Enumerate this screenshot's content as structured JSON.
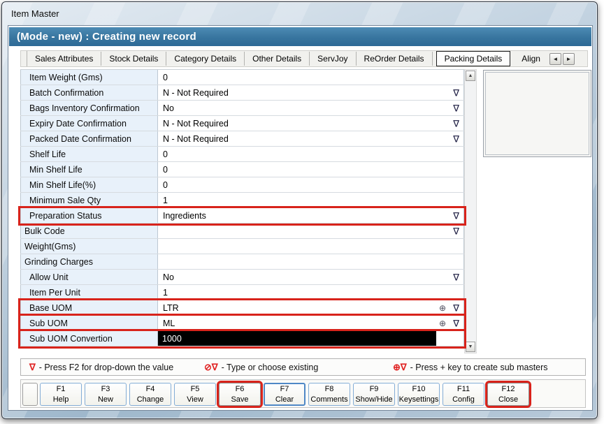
{
  "window": {
    "title": "Item Master"
  },
  "header": {
    "title": "(Mode - new) : Creating new record"
  },
  "icons": {
    "dropdown": "∇",
    "circle_plus": "⊕",
    "circle_slash": "⊘",
    "scroll_up": "▲",
    "scroll_down": "▼",
    "tab_scroll_left": "◄",
    "tab_scroll_right": "►"
  },
  "tabs": {
    "items": [
      {
        "label": "Sales Attributes",
        "selected": false
      },
      {
        "label": "Stock Details",
        "selected": false
      },
      {
        "label": "Category Details",
        "selected": false
      },
      {
        "label": "Other Details",
        "selected": false
      },
      {
        "label": "ServJoy",
        "selected": false
      },
      {
        "label": "ReOrder Details",
        "selected": false
      },
      {
        "label": "Packing Details",
        "selected": true
      },
      {
        "label": "Align",
        "selected": false
      }
    ]
  },
  "form": {
    "rows": [
      {
        "label": "Item Weight (Gms)",
        "value": "0",
        "indicator": "none",
        "highlight": false,
        "outdent": false,
        "selected": false
      },
      {
        "label": "Batch Confirmation",
        "value": "N - Not Required",
        "indicator": "dropdown",
        "highlight": false,
        "outdent": false,
        "selected": false
      },
      {
        "label": "Bags Inventory Confirmation",
        "value": "No",
        "indicator": "dropdown",
        "highlight": false,
        "outdent": false,
        "selected": false
      },
      {
        "label": "Expiry Date Confirmation",
        "value": "N - Not Required",
        "indicator": "dropdown",
        "highlight": false,
        "outdent": false,
        "selected": false
      },
      {
        "label": "Packed Date Confirmation",
        "value": "N - Not Required",
        "indicator": "dropdown",
        "highlight": false,
        "outdent": false,
        "selected": false
      },
      {
        "label": "Shelf Life",
        "value": "0",
        "indicator": "none",
        "highlight": false,
        "outdent": false,
        "selected": false
      },
      {
        "label": "Min Shelf Life",
        "value": "0",
        "indicator": "none",
        "highlight": false,
        "outdent": false,
        "selected": false
      },
      {
        "label": "Min Shelf Life(%)",
        "value": "0",
        "indicator": "none",
        "highlight": false,
        "outdent": false,
        "selected": false
      },
      {
        "label": "Minimum Sale Qty",
        "value": "1",
        "indicator": "none",
        "highlight": false,
        "outdent": false,
        "selected": false
      },
      {
        "label": "Preparation Status",
        "value": "Ingredients",
        "indicator": "dropdown",
        "highlight": true,
        "outdent": false,
        "selected": false
      },
      {
        "label": "Bulk Code",
        "value": "",
        "indicator": "dropdown",
        "highlight": false,
        "outdent": true,
        "selected": false
      },
      {
        "label": "Weight(Gms)",
        "value": "",
        "indicator": "none",
        "highlight": false,
        "outdent": true,
        "selected": false
      },
      {
        "label": "Grinding Charges",
        "value": "",
        "indicator": "none",
        "highlight": false,
        "outdent": true,
        "selected": false
      },
      {
        "label": "Allow Unit",
        "value": "No",
        "indicator": "dropdown",
        "highlight": false,
        "outdent": false,
        "selected": false
      },
      {
        "label": "Item Per Unit",
        "value": "1",
        "indicator": "none",
        "highlight": false,
        "outdent": false,
        "selected": false
      },
      {
        "label": "Base UOM",
        "value": "LTR",
        "indicator": "plus-dropdown",
        "highlight": true,
        "outdent": false,
        "selected": false
      },
      {
        "label": "Sub UOM",
        "value": "ML",
        "indicator": "plus-dropdown",
        "highlight": true,
        "outdent": false,
        "selected": false
      },
      {
        "label": "Sub UOM Convertion",
        "value": "1000",
        "indicator": "none",
        "highlight": true,
        "outdent": false,
        "selected": true
      }
    ]
  },
  "legend": {
    "items": [
      {
        "symbol": "∇",
        "text": "- Press F2 for drop-down the value"
      },
      {
        "symbol": "⊘∇",
        "text": "- Type or choose existing"
      },
      {
        "symbol": "⊕∇",
        "text": "- Press + key to create sub masters"
      }
    ]
  },
  "function_bar": {
    "buttons": [
      {
        "key": "",
        "label": "",
        "small": true,
        "highlight": false,
        "focused": false
      },
      {
        "key": "F1",
        "label": "Help",
        "small": false,
        "highlight": false,
        "focused": false
      },
      {
        "key": "F3",
        "label": "New",
        "small": false,
        "highlight": false,
        "focused": false
      },
      {
        "key": "F4",
        "label": "Change",
        "small": false,
        "highlight": false,
        "focused": false
      },
      {
        "key": "F5",
        "label": "View",
        "small": false,
        "highlight": false,
        "focused": false
      },
      {
        "key": "F6",
        "label": "Save",
        "small": false,
        "highlight": true,
        "focused": false
      },
      {
        "key": "F7",
        "label": "Clear",
        "small": false,
        "highlight": false,
        "focused": true
      },
      {
        "key": "F8",
        "label": "Comments",
        "small": false,
        "highlight": false,
        "focused": false
      },
      {
        "key": "F9",
        "label": "Show/Hide",
        "small": false,
        "highlight": false,
        "focused": false
      },
      {
        "key": "F10",
        "label": "Keysettings",
        "small": false,
        "highlight": false,
        "focused": false
      },
      {
        "key": "F11",
        "label": "Config",
        "small": false,
        "highlight": false,
        "focused": false
      },
      {
        "key": "F12",
        "label": "Close",
        "small": false,
        "highlight": true,
        "focused": false
      }
    ]
  },
  "colors": {
    "accent_red": "#d8231b",
    "header_blue": "#38759f",
    "label_cell_blue": "#e8f1fa",
    "selection_black": "#000000",
    "legend_symbol_red": "#e02222"
  }
}
